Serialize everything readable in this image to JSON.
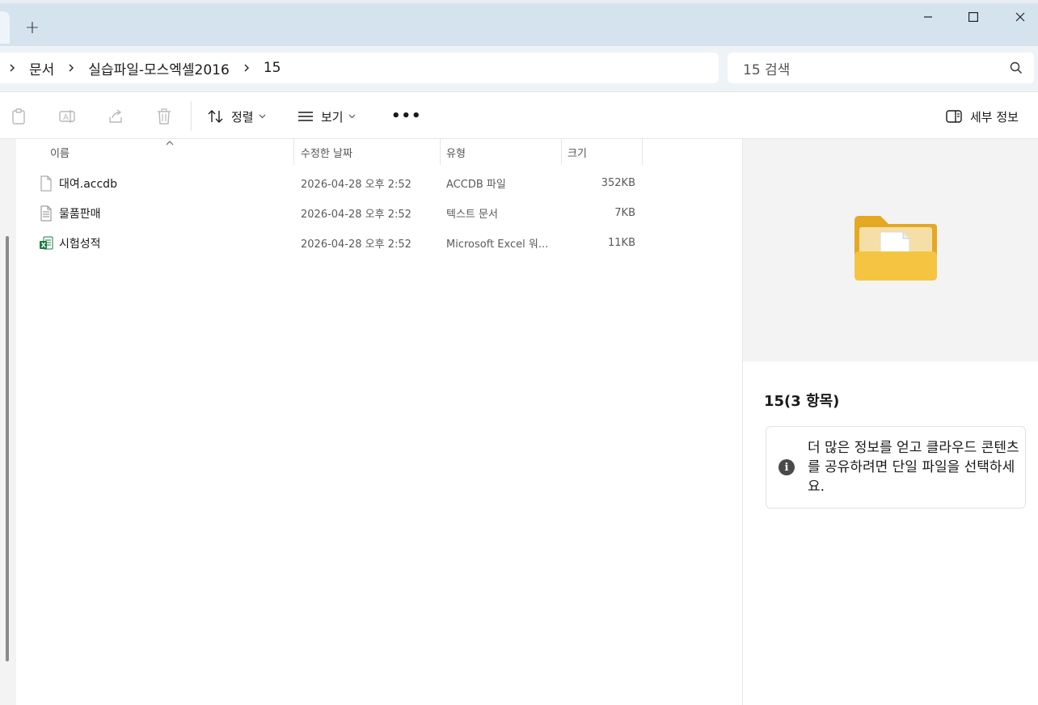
{
  "window": {
    "new_tab_label": "+",
    "minimize_label": "─",
    "maximize_label": "☐",
    "close_label": "✕"
  },
  "breadcrumb": {
    "items": [
      "문서",
      "실습파일-모스엑셀2016",
      "15"
    ]
  },
  "search": {
    "placeholder": "15 검색"
  },
  "toolbar": {
    "sort_label": "정렬",
    "view_label": "보기",
    "more_label": "•••",
    "details_label": "세부 정보"
  },
  "columns": {
    "name": "이름",
    "modified": "수정한 날짜",
    "type": "유형",
    "size": "크기"
  },
  "files": [
    {
      "name": "대여.accdb",
      "modified": "2026-04-28 오후 2:52",
      "type": "ACCDB 파일",
      "size": "352KB",
      "icon": "blank-file-icon"
    },
    {
      "name": "물품판매",
      "modified": "2026-04-28 오후 2:52",
      "type": "텍스트 문서",
      "size": "7KB",
      "icon": "text-file-icon"
    },
    {
      "name": "시험성적",
      "modified": "2026-04-28 오후 2:52",
      "type": "Microsoft Excel 워...",
      "size": "11KB",
      "icon": "excel-file-icon"
    }
  ],
  "details": {
    "title": "15(3 항목)",
    "info_text": "더 많은 정보를 얻고 클라우드 콘텐츠를 공유하려면 단일 파일을 선택하세요."
  },
  "colors": {
    "titlebar": "#d5e3ef",
    "address_row": "#eef3f8",
    "folder_yellow": "#f5c542",
    "excel_green": "#1d7a45"
  }
}
